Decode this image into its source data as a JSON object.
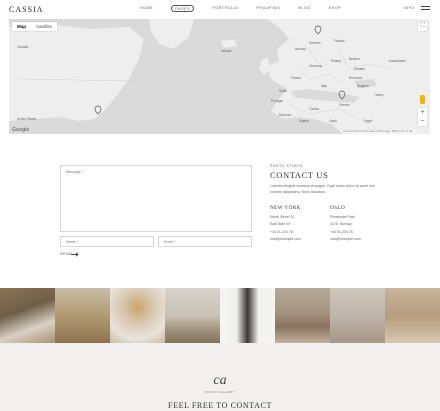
{
  "header": {
    "logo": "CASSIA",
    "nav": [
      "HOME",
      "PAGES",
      "PORTFOLIO",
      "PROOFING",
      "BLOG",
      "SHOP"
    ],
    "active_nav": "PAGES",
    "info": "INFO"
  },
  "map": {
    "tabs": [
      "Map",
      "Satellite"
    ],
    "labels": [
      "Canada",
      "United States",
      "Sweden",
      "Finland",
      "Norway",
      "Ukraine",
      "Germany",
      "France",
      "Spain",
      "Italy",
      "Poland",
      "Belarus",
      "Portugal",
      "Romania",
      "Bulgaria",
      "Greece",
      "Morocco",
      "Algeria",
      "Libya",
      "Tunisia",
      "Egypt",
      "Turkey",
      "Kazakhstan",
      "Iceland"
    ],
    "footer": "Keyboard shortcuts  Map data ©2023 Google, INEGI  Terms of Use",
    "google": "Google",
    "zoom_in": "+",
    "zoom_out": "−"
  },
  "form": {
    "message_placeholder": "Message *",
    "name_placeholder": "Name *",
    "email_placeholder": "Email *",
    "send_label": "SEND"
  },
  "contact": {
    "studio_label": "PHOTO STUDIO",
    "title": "CONTACT US",
    "description": "Lobortis feugiat vivamus at augue. Eget lorem dolor sit amet nisi nummy adipiscing. Nunc faucibus.",
    "city1": "NEW YORK",
    "addr1": [
      "Norsk Street 20",
      "East Side NY",
      "+44 01-234 78",
      "oslo@example.com"
    ],
    "city2": "OSLO",
    "addr2": [
      "Pilestredet Park",
      "0176, Norway",
      "+44 01-234 78",
      "oslo@example.com"
    ]
  },
  "footer": {
    "monogram": "ca",
    "monogram_sub": "PHOTO GALLERY",
    "cta": "FEEL FREE TO CONTACT"
  },
  "colors": {
    "map_land": "#eeeeee",
    "map_water": "#dadada",
    "footer_bg": "#f1f0ee"
  }
}
